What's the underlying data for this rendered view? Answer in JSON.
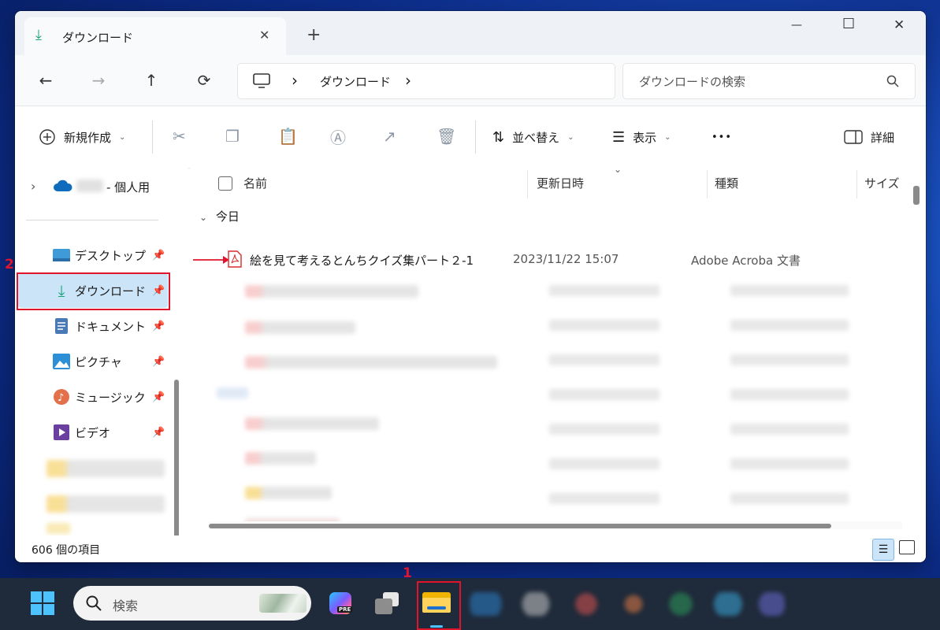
{
  "window": {
    "tab_title": "ダウンロード",
    "new_tab": "+",
    "controls": {
      "minimize": "—",
      "maximize": "☐",
      "close": "✕"
    }
  },
  "nav": {
    "back": "←",
    "forward": "→",
    "up": "↑",
    "refresh": "⟳",
    "breadcrumb_sep": "›",
    "breadcrumb_current": "ダウンロード",
    "search_placeholder": "ダウンロードの検索"
  },
  "toolbar": {
    "new": "新規作成",
    "sort": "並べ替え",
    "view": "表示",
    "more": "•••",
    "details": "詳細"
  },
  "sidebar": {
    "onedrive_label": "- 個人用",
    "items": [
      {
        "label": "デスクトップ",
        "icon": "desktop-icon"
      },
      {
        "label": "ダウンロード",
        "icon": "download-icon"
      },
      {
        "label": "ドキュメント",
        "icon": "documents-icon"
      },
      {
        "label": "ピクチャ",
        "icon": "pictures-icon"
      },
      {
        "label": "ミュージック",
        "icon": "music-icon"
      },
      {
        "label": "ビデオ",
        "icon": "videos-icon"
      }
    ]
  },
  "columns": {
    "name": "名前",
    "date": "更新日時",
    "type": "種類",
    "size": "サイズ"
  },
  "groups": {
    "today": "今日"
  },
  "files": [
    {
      "name": "絵を見て考えるとんちクイズ集パート２-1",
      "date": "2023/11/22 15:07",
      "type": "Adobe Acroba 文書"
    }
  ],
  "status": {
    "count": "606 個の項目"
  },
  "taskbar": {
    "search_placeholder": "検索",
    "pre_badge": "PRE"
  },
  "annotations": {
    "step1": "1",
    "step2": "2"
  },
  "colors": {
    "highlight": "#e0152c",
    "accent": "#0067c0",
    "selected_bg": "#cce4f7"
  }
}
